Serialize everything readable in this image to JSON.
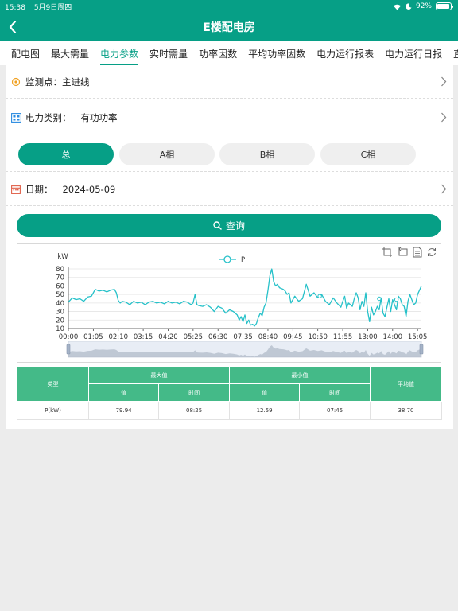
{
  "status_bar": {
    "time": "15:38",
    "date": "5月9日周四",
    "battery_pct": "92%"
  },
  "nav": {
    "title": "E楼配电房"
  },
  "tabs": [
    "配电图",
    "最大需量",
    "电力参数",
    "实时需量",
    "功率因数",
    "平均功率因数",
    "电力运行报表",
    "电力运行日报",
    "直流"
  ],
  "active_tab": 2,
  "filters": {
    "monitor_label": "监测点：",
    "monitor_value": "主进线",
    "type_label": "电力类别：",
    "type_value": "有功功率",
    "date_label": "日期：",
    "date_value": "2024-05-09"
  },
  "phases": [
    "总",
    "A相",
    "B相",
    "C相"
  ],
  "active_phase": 0,
  "query_label": "查询",
  "colors": {
    "primary": "#069f86",
    "line": "#26c1c9",
    "table_header": "#44ba88"
  },
  "chart_data": {
    "type": "line",
    "ylabel": "kW",
    "ylim": [
      10,
      80
    ],
    "yticks": [
      10,
      20,
      30,
      40,
      50,
      60,
      70,
      80
    ],
    "xticks": [
      "00:00",
      "01:05",
      "02:10",
      "03:15",
      "04:20",
      "05:25",
      "06:30",
      "07:35",
      "08:40",
      "09:45",
      "10:50",
      "11:55",
      "13:00",
      "14:00",
      "15:05"
    ],
    "legend": "top-center",
    "series": [
      {
        "name": "P",
        "x_minutes": [
          0,
          10,
          20,
          30,
          40,
          50,
          60,
          65,
          70,
          80,
          90,
          100,
          110,
          120,
          125,
          130,
          135,
          140,
          150,
          160,
          170,
          180,
          190,
          200,
          210,
          220,
          230,
          240,
          250,
          260,
          270,
          280,
          290,
          300,
          310,
          320,
          325,
          330,
          335,
          340,
          350,
          360,
          370,
          380,
          390,
          400,
          410,
          420,
          430,
          440,
          445,
          450,
          455,
          460,
          465,
          470,
          475,
          480,
          485,
          490,
          495,
          500,
          505,
          510,
          515,
          520,
          525,
          530,
          535,
          540,
          545,
          550,
          560,
          565,
          570,
          575,
          580,
          590,
          600,
          610,
          620,
          630,
          640,
          650,
          660,
          670,
          680,
          690,
          700,
          710,
          715,
          720,
          725,
          730,
          735,
          740,
          745,
          750,
          755,
          760,
          765,
          770,
          775,
          780,
          785,
          790,
          795,
          800,
          805,
          810,
          815,
          820,
          825,
          830,
          835,
          840,
          845,
          850,
          855,
          860,
          865,
          870,
          875,
          880,
          885,
          890,
          895,
          900,
          905,
          910,
          915,
          920
        ],
        "values": [
          41,
          46,
          44,
          45,
          42,
          47,
          48,
          52,
          56,
          54,
          55,
          53,
          55,
          56,
          52,
          43,
          40,
          42,
          41,
          38,
          42,
          40,
          41,
          38,
          41,
          42,
          40,
          41,
          39,
          42,
          40,
          41,
          39,
          42,
          41,
          38,
          40,
          50,
          38,
          37,
          36,
          38,
          35,
          30,
          36,
          34,
          28,
          32,
          30,
          26,
          20,
          24,
          18,
          26,
          16,
          20,
          14,
          15,
          13,
          16,
          23,
          28,
          25,
          35,
          40,
          55,
          72,
          79.94,
          65,
          60,
          62,
          58,
          56,
          54,
          50,
          52,
          40,
          48,
          42,
          45,
          62,
          48,
          52,
          46,
          50,
          42,
          38,
          46,
          40,
          35,
          42,
          48,
          34,
          40,
          38,
          36,
          45,
          52,
          46,
          32,
          42,
          36,
          52,
          30,
          18,
          35,
          26,
          30,
          36,
          32,
          46,
          28,
          24,
          35,
          45,
          30,
          44,
          38,
          32,
          48,
          45,
          38,
          36,
          24,
          42,
          50,
          44,
          38,
          40,
          50,
          55,
          60,
          66,
          70,
          50,
          40
        ]
      }
    ]
  },
  "stats_table": {
    "headers": {
      "type": "类型",
      "max": "最大值",
      "min": "最小值",
      "avg": "平均值",
      "value": "值",
      "time": "时间"
    },
    "rows": [
      {
        "type": "P(kW)",
        "max_value": "79.94",
        "max_time": "08:25",
        "min_value": "12.59",
        "min_time": "07:45",
        "avg": "38.70"
      }
    ]
  }
}
